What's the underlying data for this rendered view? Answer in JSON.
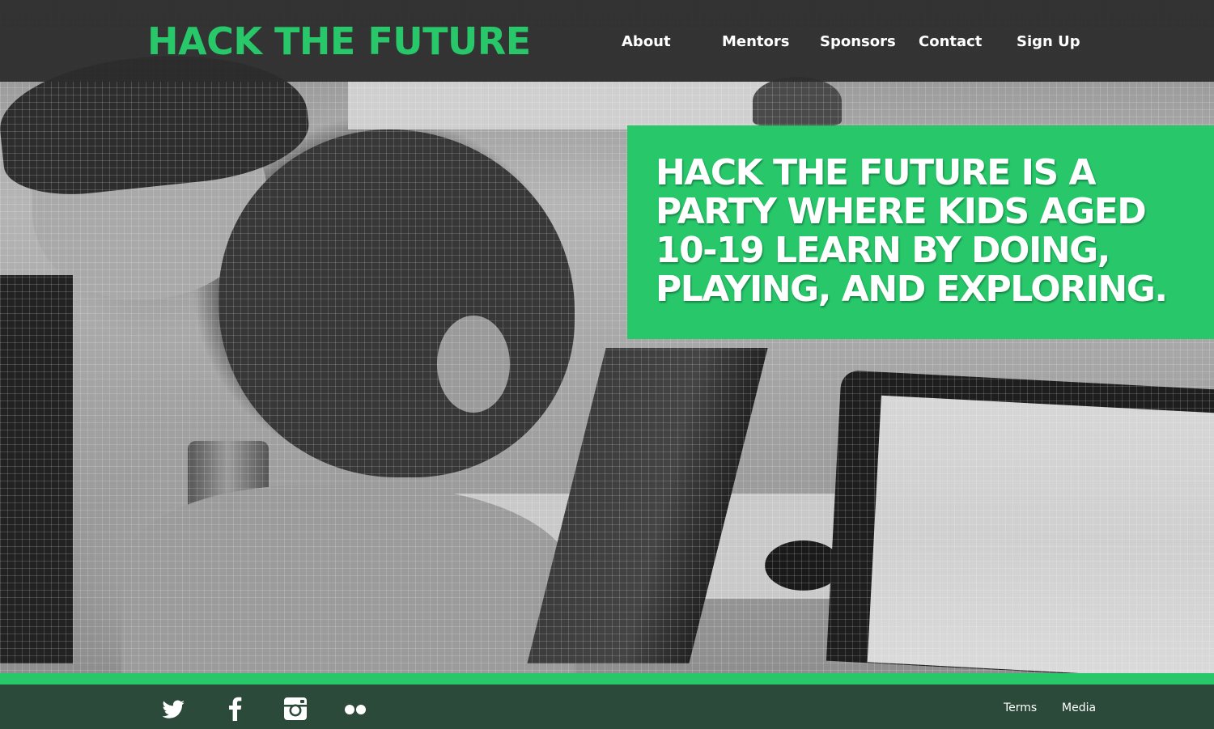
{
  "site": {
    "logo_text": "HACK THE FUTURE"
  },
  "nav": {
    "items": [
      {
        "label": "About"
      },
      {
        "label": "Mentors"
      },
      {
        "label": "Sponsors"
      },
      {
        "label": "Contact"
      },
      {
        "label": "Sign Up"
      }
    ]
  },
  "hero": {
    "tagline": "HACK THE FUTURE IS A PARTY WHERE KIDS AGED 10-19 LEARN BY DOING, PLAYING, AND EXPLORING.",
    "image_style": "greyscale photo with grid overlay"
  },
  "footer": {
    "social": [
      {
        "icon": "twitter-icon"
      },
      {
        "icon": "facebook-icon"
      },
      {
        "icon": "instagram-icon"
      },
      {
        "icon": "flickr-icon"
      }
    ],
    "links": [
      {
        "label": "Terms"
      },
      {
        "label": "Media"
      }
    ]
  },
  "colors": {
    "brand_green": "#27c76a",
    "header_bg": "#2d2d2d",
    "footer_bg": "#2b4a3a",
    "text_light": "#ffffff"
  }
}
